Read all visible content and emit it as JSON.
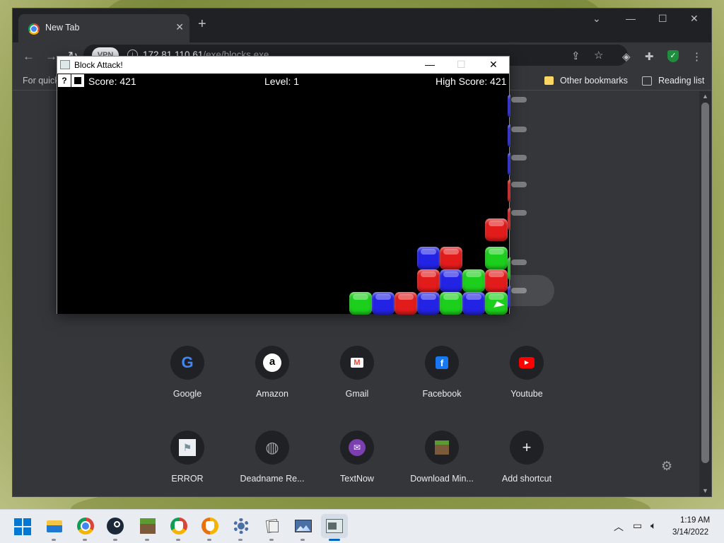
{
  "browser": {
    "tab_title": "New Tab",
    "tab_close": "✕",
    "new_tab": "+",
    "window_controls": {
      "tabsearch": "⌄",
      "minimize": "—",
      "maximize": "☐",
      "close": "✕"
    },
    "vpn_label": "VPN",
    "url_host": "172.81.110.61",
    "url_path": "/exe/blocks.exe",
    "bookmarks": {
      "left_text": "For quick",
      "other": "Other bookmarks",
      "reading_list": "Reading list"
    },
    "icons": [
      "back-icon",
      "forward-icon",
      "reload-icon",
      "share-icon",
      "star-icon",
      "adblock-icon",
      "extensions-icon",
      "shield-icon",
      "menu-icon"
    ]
  },
  "shortcuts": [
    {
      "label": "Google",
      "glyph": "G",
      "color": "#4285f4"
    },
    {
      "label": "Amazon",
      "glyph": "a",
      "color": "#ffffff"
    },
    {
      "label": "Gmail",
      "glyph": "M",
      "color": "#ea4335"
    },
    {
      "label": "Facebook",
      "glyph": "f",
      "color": "#1877f2"
    },
    {
      "label": "Youtube",
      "glyph": "▶",
      "color": "#ff0000"
    },
    {
      "label": "ERROR",
      "glyph": "⚑",
      "color": "#cfd8dc"
    },
    {
      "label": "Deadname Re...",
      "glyph": "◍",
      "color": "#9aa0a6"
    },
    {
      "label": "TextNow",
      "glyph": "✉",
      "color": "#8e44ad"
    },
    {
      "label": "Download Min...",
      "glyph": "▦",
      "color": "#6a8f3a"
    },
    {
      "label": "Add shortcut",
      "glyph": "+",
      "color": "#e8eaed"
    }
  ],
  "game": {
    "window_title": "Block Attack!",
    "help_label": "?",
    "score_label": "Score: 421",
    "level_label": "Level: 1",
    "high_score_label": "High Score: 421",
    "colors": {
      "red": "#e21b1b",
      "green": "#1ccf1c",
      "blue": "#2323e6"
    }
  },
  "taskbar": {
    "apps": [
      "windows-start-icon",
      "file-explorer-icon",
      "chrome-icon",
      "steam-icon",
      "minecraft-icon",
      "chrome-alt-icon",
      "brave-icon",
      "settings-icon",
      "files-icon",
      "photos-icon",
      "block-attack-icon"
    ],
    "time": "1:19 AM",
    "date": "3/14/2022"
  }
}
